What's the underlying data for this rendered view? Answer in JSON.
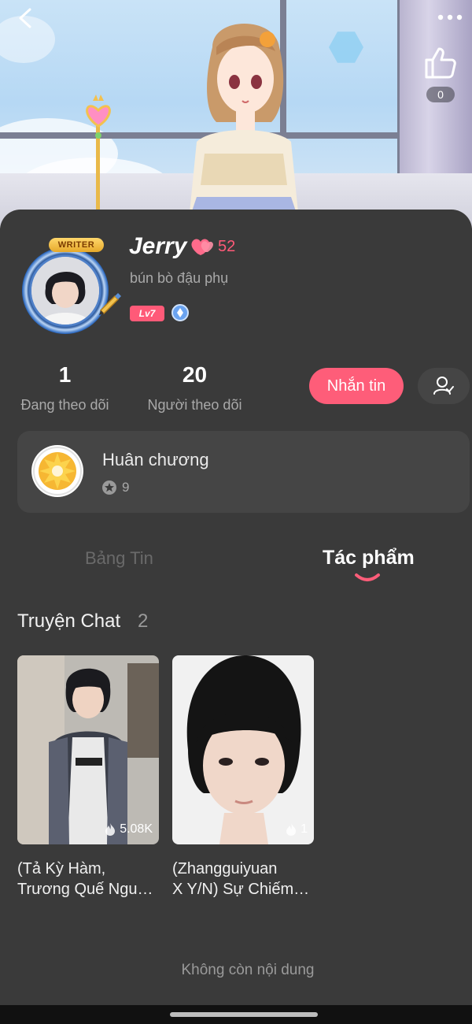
{
  "header": {
    "like_count": "0"
  },
  "profile": {
    "name": "Jerry",
    "heart_count": "52",
    "bio": "bún bò đậu phụ",
    "writer_tag": "WRITER",
    "level_badge": "Lv7"
  },
  "stats": [
    {
      "value": "1",
      "label": "Đang theo dõi"
    },
    {
      "value": "20",
      "label": "Người theo dõi"
    }
  ],
  "actions": {
    "message_label": "Nhắn tin"
  },
  "medal": {
    "title": "Huân chương",
    "count": "9"
  },
  "tabs": [
    {
      "label": "Bảng Tin",
      "active": false
    },
    {
      "label": "Tác phẩm",
      "active": true
    }
  ],
  "section": {
    "title": "Truyện Chat",
    "count": "2"
  },
  "stories": [
    {
      "title": "(Tả Kỳ Hàm,\nTrương Quế Ngu…",
      "views": "5.08K"
    },
    {
      "title": "(Zhangguiyuan\nX Y/N) Sự Chiếm…",
      "views": "1"
    }
  ],
  "footer": {
    "end_text": "Không còn nội dung"
  },
  "colors": {
    "accent": "#fe5d79",
    "background": "#3a3a3a",
    "card": "#454545"
  }
}
